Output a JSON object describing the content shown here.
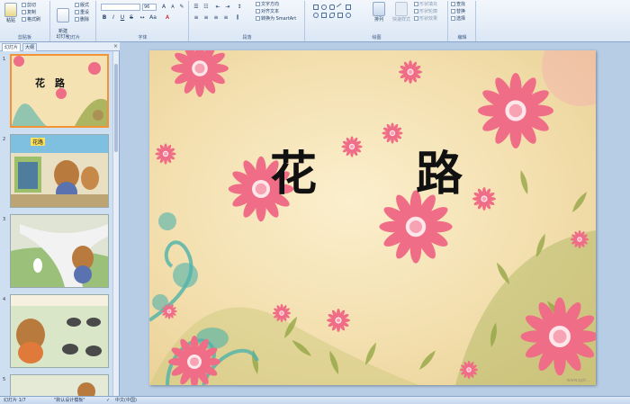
{
  "ribbon": {
    "clipboard": {
      "paste": "粘贴",
      "cut": "剪切",
      "copy": "复制",
      "format_painter": "格式刷",
      "label": "剪贴板"
    },
    "slides": {
      "new_slide": "新建\n幻灯片",
      "layout": "版式",
      "reset": "重设",
      "delete": "删除",
      "label": "幻灯片"
    },
    "font": {
      "font_name": "",
      "font_size": "96",
      "bold": "B",
      "italic": "I",
      "underline": "U",
      "strike": "S",
      "label": "字体"
    },
    "paragraph": {
      "text_direction": "文字方向",
      "align_text": "对齐文本",
      "smartart": "转换为 SmartArt",
      "label": "段落"
    },
    "drawing": {
      "arrange": "排列",
      "quick_styles": "快速样式",
      "shape_fill": "形状填充",
      "shape_outline": "形状轮廓",
      "shape_effects": "形状效果",
      "label": "绘图"
    },
    "editing": {
      "find": "查找",
      "replace": "替换",
      "select": "选择",
      "label": "编辑"
    }
  },
  "pane": {
    "tab_slides": "幻灯片",
    "tab_outline": "大纲",
    "close": "×",
    "slide_numbers": [
      "1",
      "2",
      "3",
      "4",
      "5"
    ],
    "thumb1_title": "花　路",
    "thumb2_caption": "花路"
  },
  "slide": {
    "title_char_1": "花",
    "title_char_2": "路",
    "watermark": "www.ppt..."
  },
  "statusbar": {
    "slide_count": "幻灯片 1/7",
    "theme": "\"默认设计模板\"",
    "language": "中文(中国)"
  },
  "colors": {
    "petal": "#ef6d86",
    "petal_light": "#f7a3b4",
    "leaf": "#8fa33f",
    "teal": "#4fb3ab",
    "accent": "#f29436"
  }
}
